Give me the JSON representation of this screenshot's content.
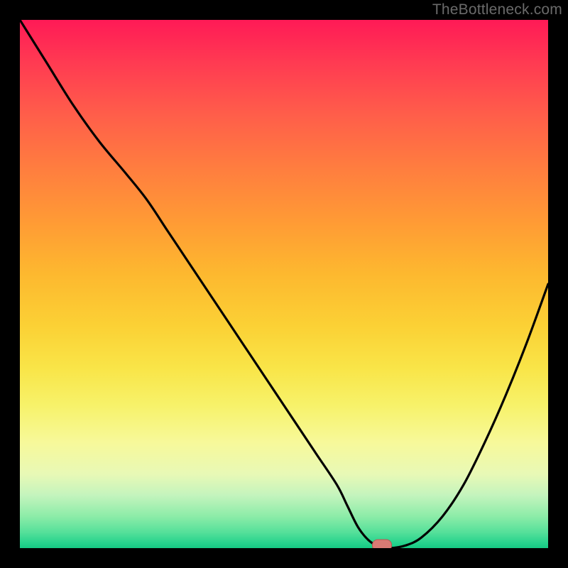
{
  "watermark": "TheBottleneck.com",
  "colors": {
    "curve_stroke": "#000000",
    "marker_fill": "#d87a74",
    "marker_border": "#b85752",
    "gradient_top": "#ff1a56",
    "gradient_bottom": "#16c983"
  },
  "chart_data": {
    "type": "line",
    "title": "",
    "xlabel": "",
    "ylabel": "",
    "x": [
      0,
      5,
      10,
      15,
      20,
      24,
      28,
      32,
      36,
      40,
      44,
      48,
      52,
      56,
      60,
      62,
      64,
      66,
      68,
      70,
      73,
      76,
      80,
      84,
      88,
      92,
      96,
      100
    ],
    "values": [
      100,
      92,
      84,
      77,
      71,
      66,
      60,
      54,
      48,
      42,
      36,
      30,
      24,
      18,
      12,
      8,
      4,
      1.5,
      0.3,
      0,
      0.5,
      2,
      6,
      12,
      20,
      29,
      39,
      50
    ],
    "xlim": [
      0,
      100
    ],
    "ylim": [
      0,
      100
    ],
    "marker": {
      "x": 68.5,
      "y": 0
    },
    "note": "Axis numbers are estimated percentages; the curve drops from top-left, reaches nearly 0 around x≈68-70 (marker), then rises to about 50 at x=100."
  }
}
